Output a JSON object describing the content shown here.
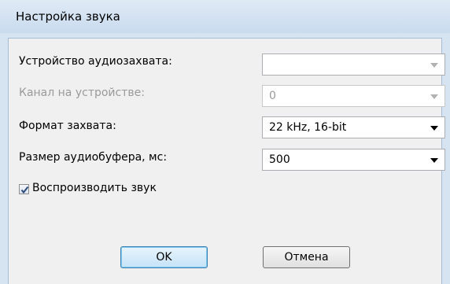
{
  "window": {
    "title": "Настройка звука"
  },
  "fields": {
    "capture_device": {
      "label": "Устройство аудиозахвата:",
      "value": "",
      "enabled": true
    },
    "device_channel": {
      "label": "Канал на устройстве:",
      "value": "0",
      "enabled": false
    },
    "capture_format": {
      "label": "Формат захвата:",
      "value": "22 kHz, 16-bit",
      "enabled": true
    },
    "buffer_size": {
      "label": "Размер аудиобуфера, мс:",
      "value": "500",
      "enabled": true
    }
  },
  "play_sound": {
    "label": "Воспроизводить звук",
    "checked": true
  },
  "buttons": {
    "ok": "OK",
    "cancel": "Отмена"
  },
  "icons": {
    "dropdown": "chevron-down-icon",
    "check": "checkmark-icon"
  },
  "colors": {
    "accent": "#3c7fb1",
    "disabled_text": "#9a9a9a",
    "title_bar": "#d6e4f2"
  }
}
